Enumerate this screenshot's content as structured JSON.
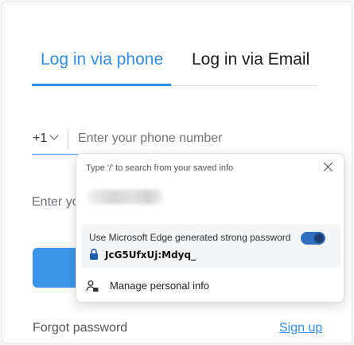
{
  "tabs": [
    {
      "label": "Log in via phone",
      "active": true
    },
    {
      "label": "Log in via Email",
      "active": false
    }
  ],
  "phone": {
    "country_code": "+1",
    "placeholder": "Enter your phone number"
  },
  "password": {
    "placeholder": "Enter yo"
  },
  "footer": {
    "forgot_label": "Forgot password",
    "signup_label": "Sign up"
  },
  "autofill": {
    "hint": "Type '/' to search from your saved info",
    "strong_password_label": "Use Microsoft Edge generated strong password",
    "strong_password_value": "JcG5UfxUj:Mdyq_",
    "toggle_on": true,
    "manage_label": "Manage personal info"
  },
  "colors": {
    "accent": "#2f8ee8",
    "button": "#3d95e9",
    "toggle": "#2f6fbe"
  }
}
